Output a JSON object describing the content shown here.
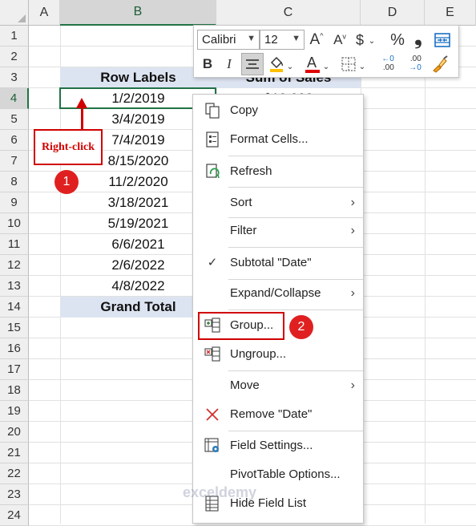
{
  "columns": [
    "A",
    "B",
    "C",
    "D",
    "E"
  ],
  "rows": [
    "1",
    "2",
    "3",
    "4",
    "5",
    "6",
    "7",
    "8",
    "9",
    "10",
    "11",
    "12",
    "13",
    "14",
    "15",
    "16",
    "17",
    "18",
    "19",
    "20",
    "21",
    "22",
    "23",
    "24"
  ],
  "pivot": {
    "row_labels_header": "Row Labels",
    "sum_header": "Sum of Sales",
    "dates": [
      "1/2/2019",
      "3/4/2019",
      "7/4/2019",
      "8/15/2020",
      "11/2/2020",
      "3/18/2021",
      "5/19/2021",
      "6/6/2021",
      "2/6/2022",
      "4/8/2022"
    ],
    "partial_value": "$10,000",
    "grand_total": "Grand Total"
  },
  "annotation": {
    "callout_text": "Right-click",
    "step1": "1",
    "step2": "2",
    "color": "#d00000"
  },
  "mini_toolbar": {
    "font_name": "Calibri",
    "font_size": "12",
    "increase_font": "A",
    "decrease_font": "A",
    "currency": "$",
    "percent": "%",
    "comma": "❟",
    "bold": "B",
    "italic": "I",
    "font_color_letter": "A",
    "inc_decimal": ".00",
    "dec_decimal": ".00"
  },
  "context_menu": {
    "items": [
      {
        "label": "Copy",
        "icon": "copy-icon"
      },
      {
        "label": "Format Cells...",
        "icon": "format-cells-icon"
      },
      {
        "label": "Refresh",
        "icon": "refresh-icon"
      },
      {
        "label": "Sort",
        "icon": "",
        "submenu": "›"
      },
      {
        "label": "Filter",
        "icon": "",
        "submenu": "›"
      },
      {
        "label": "Subtotal \"Date\"",
        "icon": "checkmark-icon"
      },
      {
        "label": "Expand/Collapse",
        "icon": "",
        "submenu": "›"
      },
      {
        "label": "Group...",
        "icon": "group-icon"
      },
      {
        "label": "Ungroup...",
        "icon": "ungroup-icon"
      },
      {
        "label": "Move",
        "icon": "",
        "submenu": "›"
      },
      {
        "label": "Remove \"Date\"",
        "icon": "remove-x-icon"
      },
      {
        "label": "Field Settings...",
        "icon": "field-settings-icon"
      },
      {
        "label": "PivotTable Options...",
        "icon": ""
      },
      {
        "label": "Hide Field List",
        "icon": "field-list-icon"
      }
    ]
  },
  "watermark": "exceldemy",
  "colors": {
    "accent_green": "#217346",
    "header_fill": "#dde4f1",
    "annotation_red": "#d00000"
  }
}
